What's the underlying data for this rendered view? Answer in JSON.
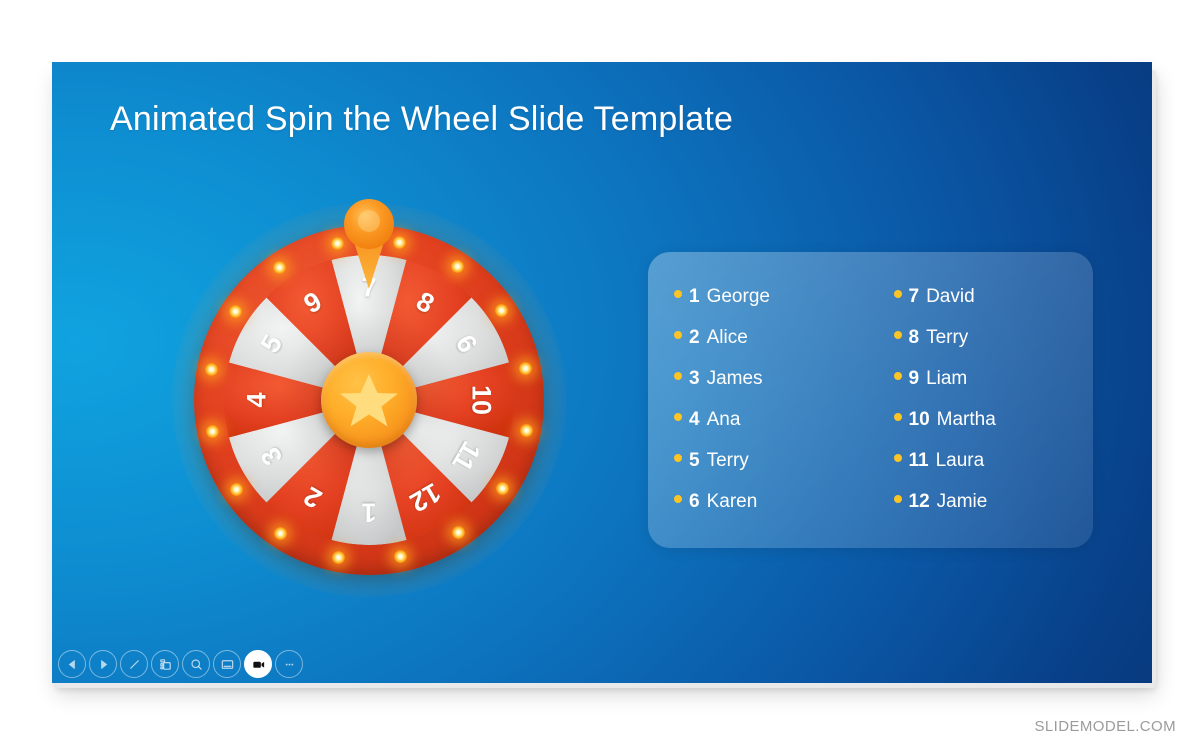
{
  "slide": {
    "title": "Animated Spin the Wheel Slide Template",
    "background_left_color": "#10a3e0",
    "background_right_color": "#06326f"
  },
  "wheel": {
    "rim_color": "#e2411f",
    "segment_red_color": "#e24321",
    "segment_grey_color": "#d9dadb",
    "hub_color": "#f7941d",
    "hub_star_color": "#ffd76b",
    "pointer_color": "#f7941d",
    "bulb_color": "#ffc637",
    "bulb_count": 16,
    "segments": [
      {
        "number": "1"
      },
      {
        "number": "2"
      },
      {
        "number": "3"
      },
      {
        "number": "4"
      },
      {
        "number": "5"
      },
      {
        "number": "6"
      },
      {
        "number": "7"
      },
      {
        "number": "8"
      },
      {
        "number": "9"
      },
      {
        "number": "10"
      },
      {
        "number": "11"
      },
      {
        "number": "12"
      }
    ]
  },
  "transport": {
    "play_label": "play-icon",
    "pause_label": "pause-icon",
    "background_color": "#f8a31d"
  },
  "names_panel": {
    "bullet_color": "#fcc425",
    "columns": [
      {
        "items": [
          {
            "num": "1",
            "name": "George"
          },
          {
            "num": "2",
            "name": "Alice"
          },
          {
            "num": "3",
            "name": "James"
          },
          {
            "num": "4",
            "name": "Ana"
          },
          {
            "num": "5",
            "name": "Terry"
          },
          {
            "num": "6",
            "name": "Karen"
          }
        ]
      },
      {
        "items": [
          {
            "num": "7",
            "name": "David"
          },
          {
            "num": "8",
            "name": "Terry"
          },
          {
            "num": "9",
            "name": "Liam"
          },
          {
            "num": "10",
            "name": "Martha"
          },
          {
            "num": "11",
            "name": "Laura"
          },
          {
            "num": "12",
            "name": "Jamie"
          }
        ]
      }
    ]
  },
  "toolbar": {
    "items": [
      {
        "icon": "previous-slide-icon",
        "active": false
      },
      {
        "icon": "next-slide-icon",
        "active": false
      },
      {
        "icon": "pen-icon",
        "active": false
      },
      {
        "icon": "all-slides-icon",
        "active": false
      },
      {
        "icon": "zoom-icon",
        "active": false
      },
      {
        "icon": "presenter-view-icon",
        "active": false
      },
      {
        "icon": "record-icon",
        "active": true
      },
      {
        "icon": "more-options-icon",
        "active": false
      }
    ]
  },
  "watermark": {
    "text": "SLIDEMODEL.COM"
  }
}
